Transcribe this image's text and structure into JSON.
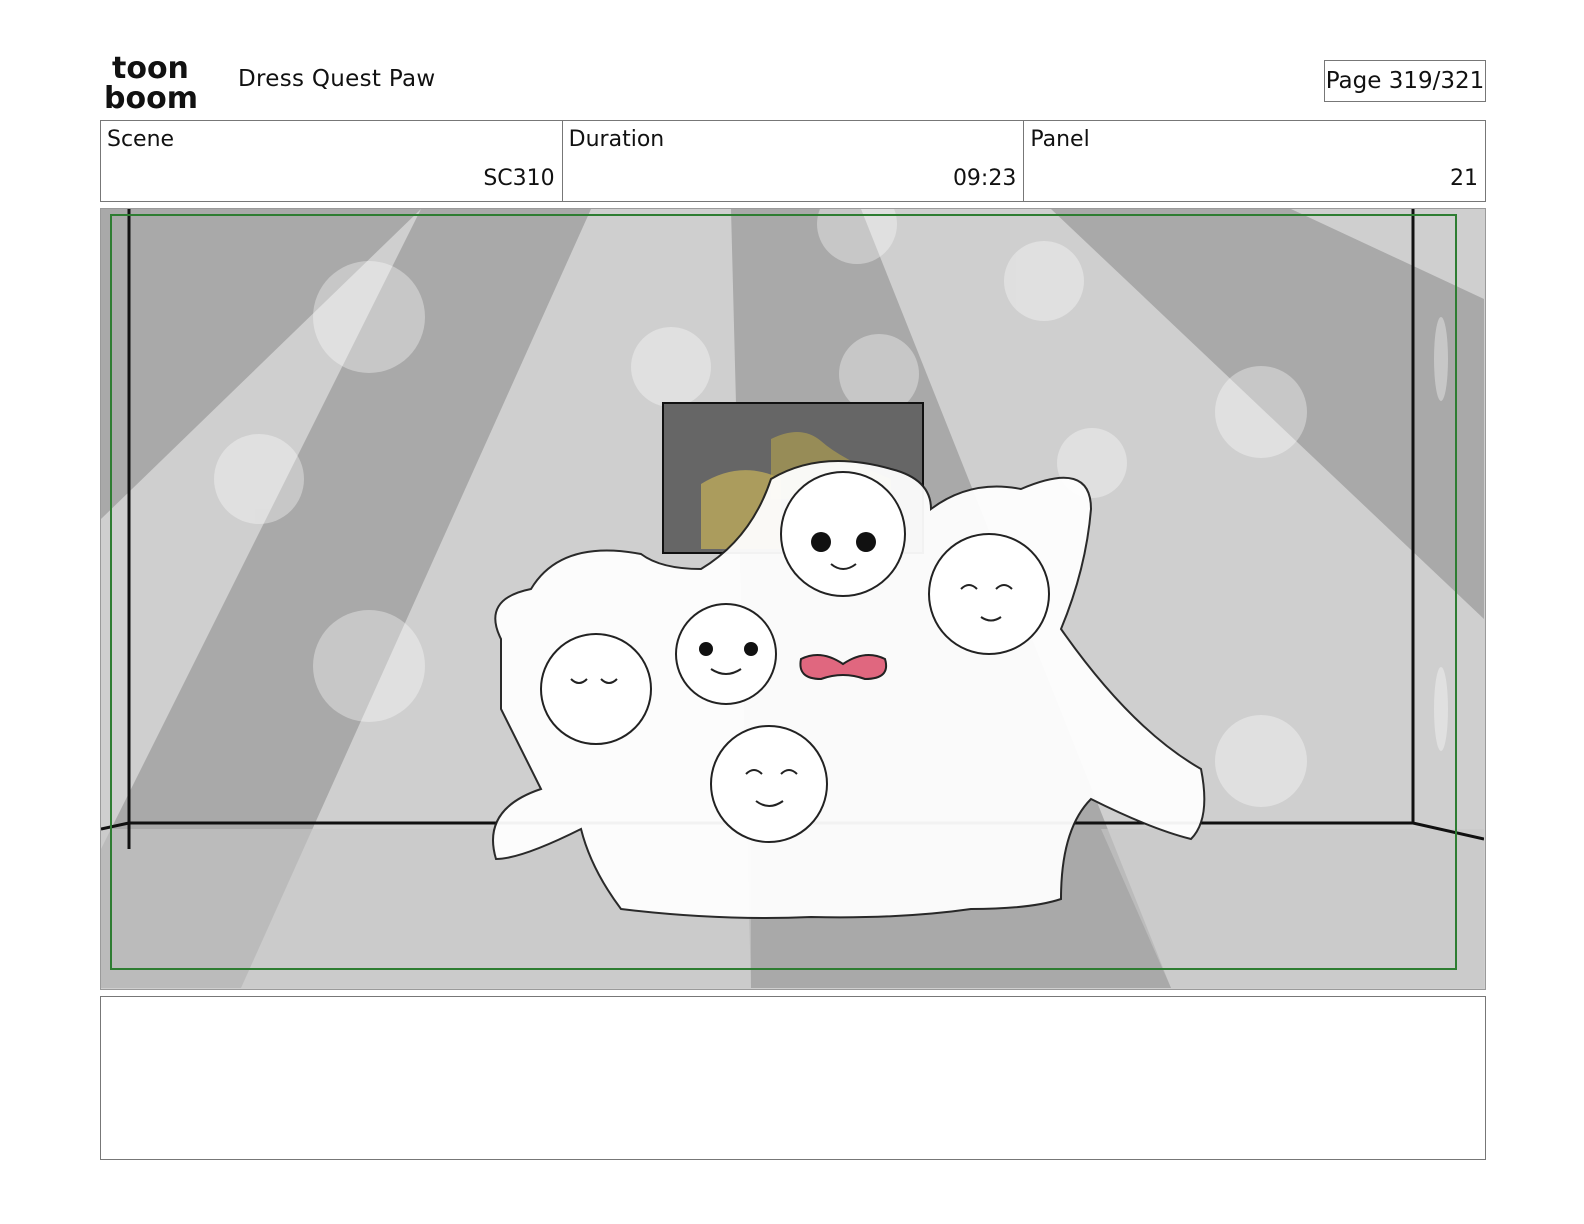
{
  "header": {
    "logo_line1": "toon",
    "logo_line2": "boom",
    "project_title": "Dress Quest Paw",
    "page_label": "Page 319/321"
  },
  "info": {
    "scene_label": "Scene",
    "scene_value": "SC310",
    "duration_label": "Duration",
    "duration_value": "09:23",
    "panel_label": "Panel",
    "panel_value": "21"
  },
  "notes": {
    "text": ""
  },
  "colors": {
    "safe_frame": "#2e7d32",
    "bow": "#e0677f",
    "background_gray": "#cfcfcf"
  }
}
